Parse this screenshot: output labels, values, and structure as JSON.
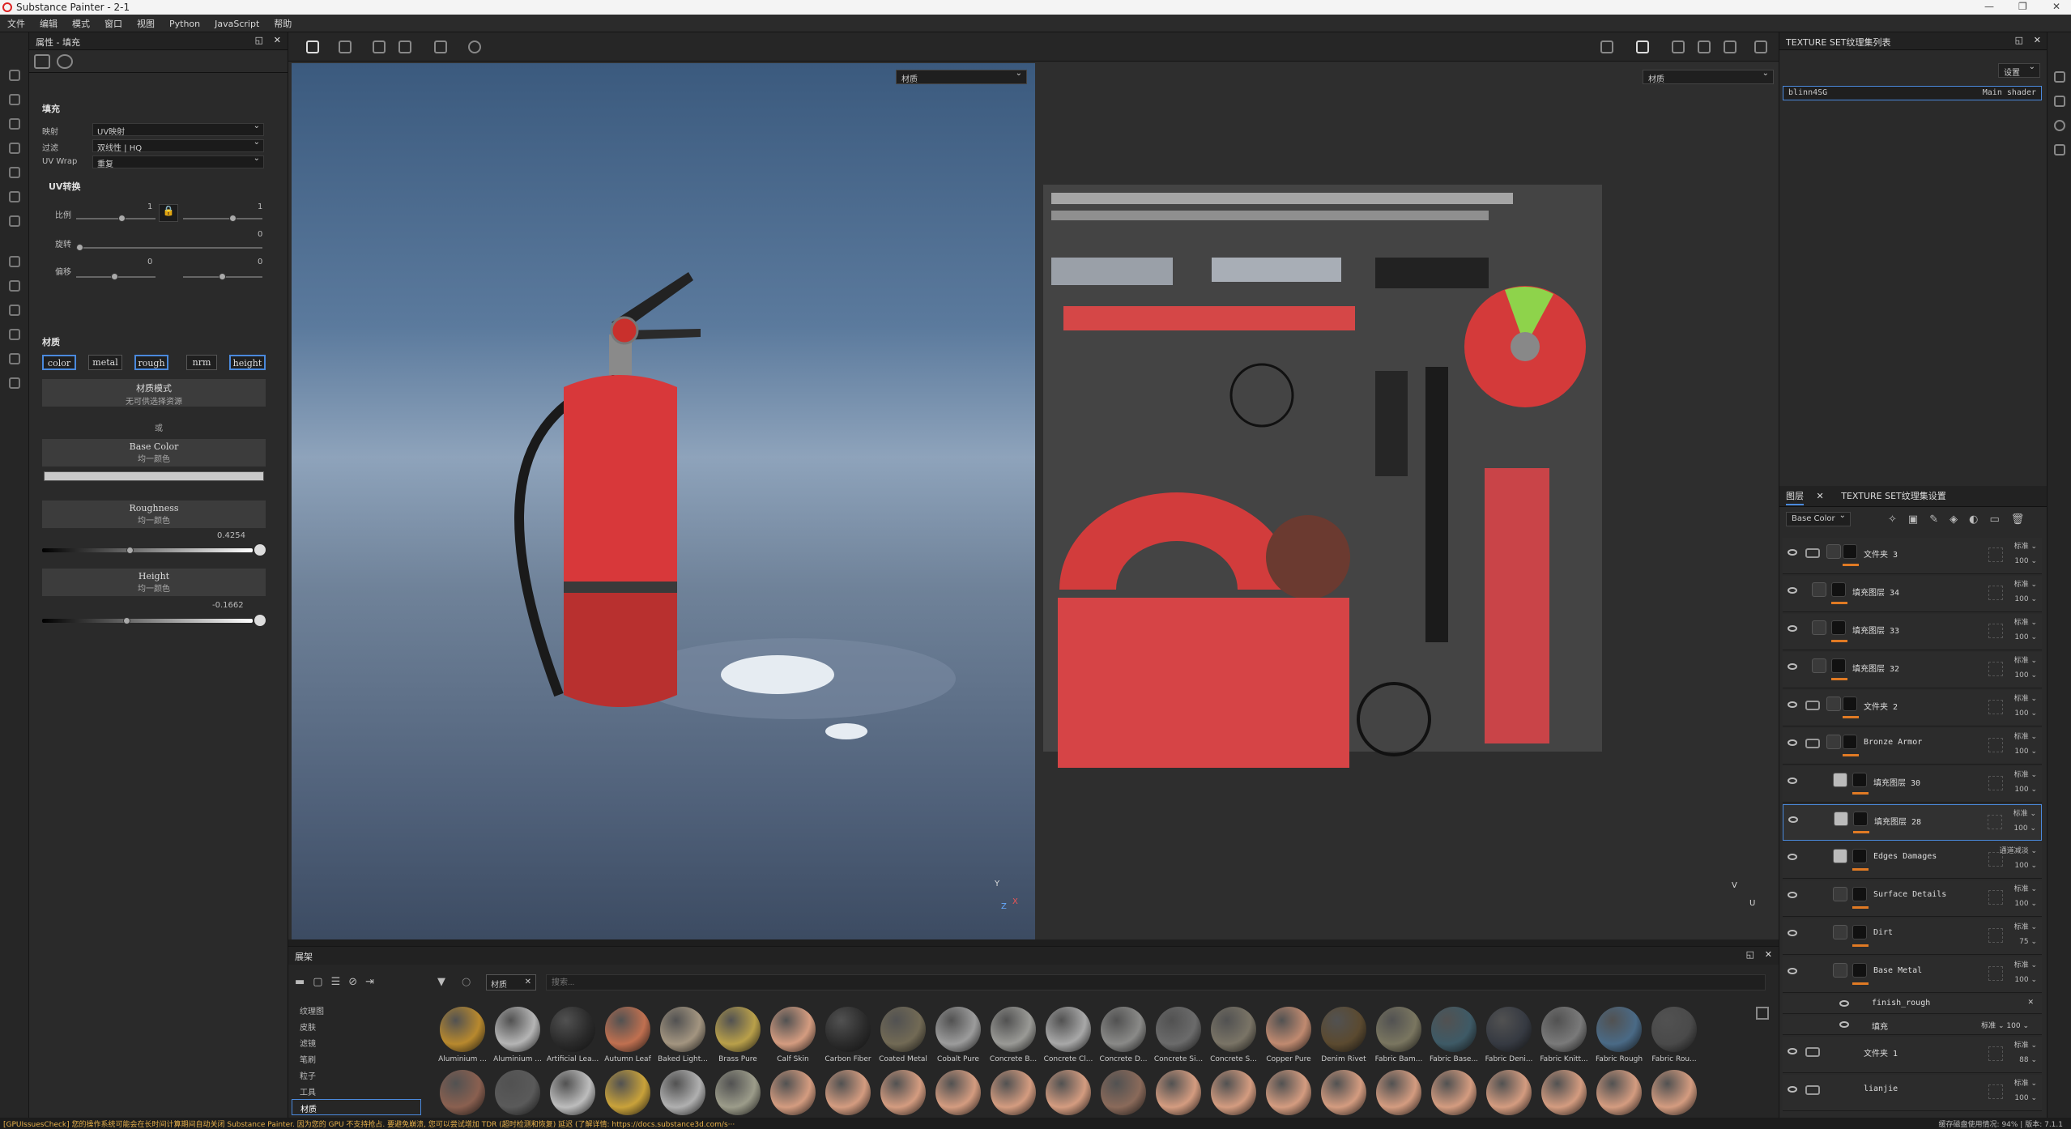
{
  "app": {
    "title": "Substance Painter - 2-1"
  },
  "menu": [
    "文件",
    "编辑",
    "模式",
    "窗口",
    "视图",
    "Python",
    "JavaScript",
    "帮助"
  ],
  "properties": {
    "header": "属性 - 填充",
    "fill_title": "填充",
    "mapping_label": "映射",
    "mapping_value": "UV映射",
    "filter_label": "过滤",
    "filter_value": "双线性 | HQ",
    "uvwrap_label": "UV Wrap",
    "uvwrap_value": "重复",
    "uv_transform": "UV转换",
    "scale_label": "比例",
    "scale_value": "1",
    "scale_value2": "1",
    "rotation_label": "旋转",
    "rotation_value": "0",
    "offset_label": "偏移",
    "offset_x": "0",
    "offset_y": "0",
    "material_title": "材质",
    "channels": [
      "color",
      "metal",
      "rough",
      "nrm",
      "height"
    ],
    "channels_on": [
      true,
      false,
      true,
      false,
      true
    ],
    "material_mode_title": "材质模式",
    "material_mode_sub": "无可供选择资源",
    "or_text": "或",
    "base_color_title": "Base Color",
    "base_color_sub": "均一颜色",
    "roughness_title": "Roughness",
    "roughness_sub": "均一颜色",
    "roughness_value": "0.4254",
    "roughness_fraction": 0.4254,
    "height_title": "Height",
    "height_sub": "均一颜色",
    "height_value": "-0.1662"
  },
  "viewport": {
    "left_select": "材质",
    "right_select": "材质",
    "axis_3d": {
      "y": "Y",
      "x": "X",
      "z": "Z"
    },
    "axis_2d": {
      "v": "V",
      "u": "U"
    }
  },
  "shader_panel": {
    "title": "TEXTURE SET纹理集列表",
    "settings": "设置",
    "item_name": "blinn4SG",
    "item_shader": "Main shader"
  },
  "layers_panel": {
    "tab_layers": "图层",
    "tab_settings": "TEXTURE SET纹理集设置",
    "channel_select": "Base Color",
    "layers": [
      {
        "name": "文件夹 3",
        "blend": "标准",
        "opacity": "100",
        "type": "folder",
        "indent": 0
      },
      {
        "name": "填充图层 34",
        "blend": "标准",
        "opacity": "100",
        "type": "fill",
        "indent": 0
      },
      {
        "name": "填充图层 33",
        "blend": "标准",
        "opacity": "100",
        "type": "fill",
        "indent": 0
      },
      {
        "name": "填充图层 32",
        "blend": "标准",
        "opacity": "100",
        "type": "fill",
        "indent": 0
      },
      {
        "name": "文件夹 2",
        "blend": "标准",
        "opacity": "100",
        "type": "folder",
        "indent": 0
      },
      {
        "name": "Bronze Armor",
        "blend": "标准",
        "opacity": "100",
        "type": "folder-open",
        "indent": 0
      },
      {
        "name": "填充图层 30",
        "blend": "标准",
        "opacity": "100",
        "type": "fill",
        "indent": 1
      },
      {
        "name": "填充图层 28",
        "blend": "标准",
        "opacity": "100",
        "type": "fill",
        "indent": 1,
        "selected": true
      },
      {
        "name": "Edges Damages",
        "blend": "通道减淡",
        "opacity": "100",
        "type": "fill",
        "indent": 1
      },
      {
        "name": "Surface Details",
        "blend": "标准",
        "opacity": "100",
        "type": "fill",
        "indent": 1
      },
      {
        "name": "Dirt",
        "blend": "标准",
        "opacity": "75",
        "type": "fill",
        "indent": 1
      },
      {
        "name": "Base Metal",
        "blend": "标准",
        "opacity": "100",
        "type": "fill",
        "indent": 1
      }
    ],
    "effects": [
      {
        "name": "finish_rough"
      },
      {
        "name": "填充",
        "blend": "标准",
        "opacity": "100"
      }
    ],
    "bottom_layers": [
      {
        "name": "文件夹 1",
        "blend": "标准",
        "opacity": "88"
      },
      {
        "name": "lianjie",
        "blend": "标准",
        "opacity": "100"
      }
    ]
  },
  "shelf": {
    "title": "展架",
    "filter_tag": "材质",
    "search_placeholder": "搜索...",
    "categories": [
      "纹理图",
      "皮肤",
      "滤镜",
      "笔刷",
      "粒子",
      "工具",
      "材质"
    ],
    "active_category": "材质",
    "materials": [
      {
        "name": "Aluminium ...",
        "color": "#b8892e"
      },
      {
        "name": "Aluminium ...",
        "color": "#b5b5b5"
      },
      {
        "name": "Artificial Lea...",
        "color": "#2a2a2a"
      },
      {
        "name": "Autumn Leaf",
        "color": "#c07050"
      },
      {
        "name": "Baked Light...",
        "color": "#a39580"
      },
      {
        "name": "Brass Pure",
        "color": "#b9a04a"
      },
      {
        "name": "Calf Skin",
        "color": "#d49c80"
      },
      {
        "name": "Carbon Fiber",
        "color": "#2b2b2b"
      },
      {
        "name": "Coated Metal",
        "color": "#726a55"
      },
      {
        "name": "Cobalt Pure",
        "color": "#9c9c9c"
      },
      {
        "name": "Concrete B...",
        "color": "#9a9a96"
      },
      {
        "name": "Concrete Cl...",
        "color": "#a8a8a8"
      },
      {
        "name": "Concrete D...",
        "color": "#8a8a88"
      },
      {
        "name": "Concrete Si...",
        "color": "#6b6b6b"
      },
      {
        "name": "Concrete S...",
        "color": "#7a7466"
      },
      {
        "name": "Copper Pure",
        "color": "#c08a70"
      },
      {
        "name": "Denim Rivet",
        "color": "#5b4a30"
      },
      {
        "name": "Fabric Bam...",
        "color": "#7a7660"
      },
      {
        "name": "Fabric Base...",
        "color": "#3e5a66"
      },
      {
        "name": "Fabric Deni...",
        "color": "#363a42"
      },
      {
        "name": "Fabric Knitt...",
        "color": "#7a7a7a"
      },
      {
        "name": "Fabric Rough",
        "color": "#4a6a86"
      },
      {
        "name": "Fabric Rou...",
        "color": "#4a4a4a"
      }
    ],
    "row2_colors": [
      "#8a6050",
      "#5a5a5a",
      "#bdbdbd",
      "#c9a23a",
      "#b0b0b0",
      "#9c9c8a",
      "#d49c80",
      "#d49c80",
      "#d49c80",
      "#d49c80",
      "#d49c80",
      "#d49c80",
      "#8a6a5a",
      "#d49c80",
      "#d49c80",
      "#d49c80",
      "#d49c80",
      "#d49c80",
      "#d49c80",
      "#d49c80",
      "#d49c80",
      "#d49c80",
      "#d49c80"
    ]
  },
  "status": {
    "message": "[GPUIssuesCheck] 您的操作系统可能会在长时间计算期间自动关闭 Substance Painter. 因为您的 GPU 不支持抢占. 要避免崩溃, 您可以尝试增加 TDR (超时检测和恢复) 延迟 (了解详情: https://docs.substance3d.com/s···",
    "right": "缓存磁盘使用情况:   94%  |  版本: 7.1.1"
  }
}
